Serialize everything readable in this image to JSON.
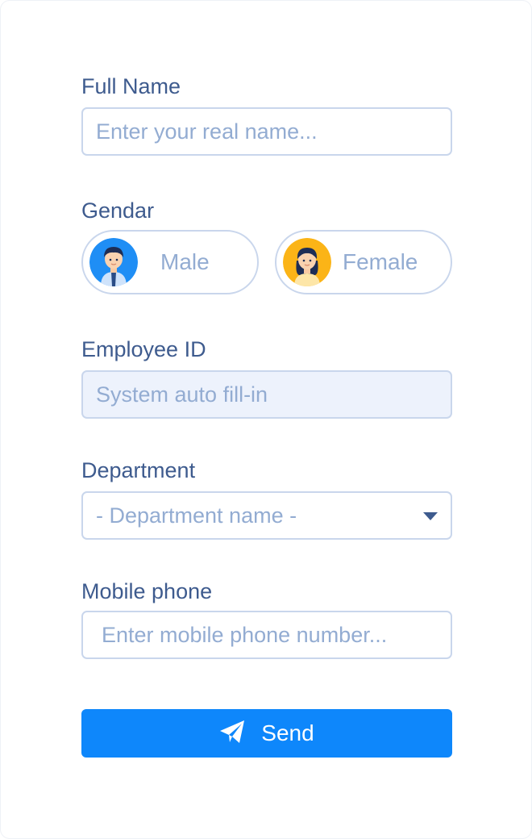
{
  "form": {
    "full_name": {
      "label": "Full Name",
      "placeholder": "Enter your real name..."
    },
    "gender": {
      "label": "Gendar",
      "options": [
        {
          "label": "Male",
          "icon": "male-avatar-icon",
          "avatar_color": "#1f8ef5"
        },
        {
          "label": "Female",
          "icon": "female-avatar-icon",
          "avatar_color": "#fbb417"
        }
      ]
    },
    "employee_id": {
      "label": "Employee ID",
      "placeholder": "System auto fill-in"
    },
    "department": {
      "label": "Department",
      "placeholder": "- Department name -",
      "icon": "caret-down-icon"
    },
    "mobile_phone": {
      "label": "Mobile phone",
      "placeholder": "Enter mobile phone number..."
    },
    "send_button": {
      "label": "Send",
      "icon": "paper-plane-icon"
    }
  },
  "colors": {
    "label": "#3e5b8e",
    "placeholder": "#93acd2",
    "border": "#c9d6ec",
    "readonly_bg": "#edf2fc",
    "accent": "#0e87fb"
  }
}
